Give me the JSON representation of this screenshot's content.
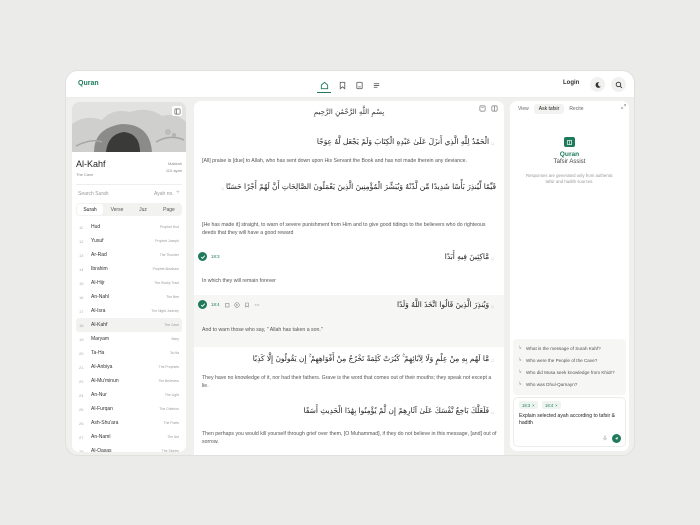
{
  "header": {
    "brand": "Quran",
    "login_label": "Login",
    "nav_icons": [
      "home-icon",
      "bookmark-icon",
      "book-icon",
      "list-icon"
    ],
    "accent_color": "#1f7a5c"
  },
  "surah": {
    "name": "Al-Kahf",
    "subtitle": "The Cave",
    "place": "Makkah",
    "ayah_count": "110 ayah",
    "search_placeholder": "Search Surah",
    "ayah_label": "Ayah no.",
    "plus": "+",
    "tabs": [
      "Surah",
      "Verse",
      "Juz",
      "Page"
    ],
    "active_tab": "Surah",
    "list": [
      {
        "num": "11",
        "name": "Hud",
        "meaning": "Prophet Hud"
      },
      {
        "num": "12",
        "name": "Yusuf",
        "meaning": "Prophet Joseph"
      },
      {
        "num": "13",
        "name": "Ar-Rad",
        "meaning": "The Thunder"
      },
      {
        "num": "14",
        "name": "Ibrahim",
        "meaning": "Prophet Abraham"
      },
      {
        "num": "15",
        "name": "Al-Hijr",
        "meaning": "The Rocky Tract"
      },
      {
        "num": "16",
        "name": "An-Nahl",
        "meaning": "The Bee"
      },
      {
        "num": "17",
        "name": "Al-Isra",
        "meaning": "The Night Journey"
      },
      {
        "num": "18",
        "name": "Al-Kahf",
        "meaning": "The Cave",
        "selected": true
      },
      {
        "num": "19",
        "name": "Maryam",
        "meaning": "Mary"
      },
      {
        "num": "20",
        "name": "Ta-Ha",
        "meaning": "Ta-Ha"
      },
      {
        "num": "21",
        "name": "Al-Anbiya",
        "meaning": "The Prophets"
      },
      {
        "num": "22",
        "name": "Al-Mu'minun",
        "meaning": "The Believers"
      },
      {
        "num": "24",
        "name": "An-Nur",
        "meaning": "The Light"
      },
      {
        "num": "25",
        "name": "Al-Furqan",
        "meaning": "The Criterion"
      },
      {
        "num": "26",
        "name": "Ash-Shu'ara",
        "meaning": "The Poets"
      },
      {
        "num": "27",
        "name": "An-Naml",
        "meaning": "The Ant"
      },
      {
        "num": "28",
        "name": "Al-Qasas",
        "meaning": "The Stories"
      }
    ]
  },
  "reader": {
    "bismillah": "بِسْمِ اللَّهِ الرَّحْمَٰنِ الرَّحِيمِ",
    "ayahs": [
      {
        "arabic": "الْحَمْدُ لِلَّهِ الَّذِي أَنزَلَ عَلَىٰ عَبْدِهِ الْكِتَابَ وَلَمْ يَجْعَل لَّهُ عِوَجًا",
        "english": "[All] praise is [due] to Allah, who has sent down upon His Servant the Book and has not made therein any deviance."
      },
      {
        "arabic": "قَيِّمًا لِّيُنذِرَ بَأْسًا شَدِيدًا مِّن لَّدُنْهُ وَيُبَشِّرَ الْمُؤْمِنِينَ الَّذِينَ يَعْمَلُونَ الصَّالِحَاتِ أَنَّ لَهُمْ أَجْرًا حَسَنًا",
        "english": "[He has made it] straight, to warn of severe punishment from Him and to give good tidings to the believers who do righteous deeds that they will have a good reward"
      },
      {
        "ref": "18:3",
        "arabic": "مَّاكِثِينَ فِيهِ أَبَدًا",
        "english": "In which they will remain forever"
      },
      {
        "ref": "18:4",
        "arabic": "وَيُنذِرَ الَّذِينَ قَالُوا اتَّخَذَ اللَّهُ وَلَدًا",
        "english": "And to warn those who say, \" Allah has taken a son.\""
      },
      {
        "arabic": "مَّا لَهُم بِهِ مِنْ عِلْمٍ وَلَا لِآبَائِهِمْ ۚ كَبُرَتْ كَلِمَةً تَخْرُجُ مِنْ أَفْوَاهِهِمْ ۚ إِن يَقُولُونَ إِلَّا كَذِبًا",
        "english": "They have no knowledge of it, nor had their fathers. Grave is the word that comes out of their mouths; they speak not except a lie."
      },
      {
        "arabic": "فَلَعَلَّكَ بَاخِعٌ نَّفْسَكَ عَلَىٰ آثَارِهِمْ إِن لَّمْ يُؤْمِنُوا بِهَٰذَا الْحَدِيثِ أَسَفًا",
        "english": "Then perhaps you would kill yourself through grief over them, [O Muhammad], if they do not believe in this message, [and] out of sorrow."
      }
    ]
  },
  "assistant": {
    "tabs": [
      "View",
      "Ask tafsir",
      "Recite"
    ],
    "active_tab": "Ask tafsir",
    "title": "Quran",
    "subtitle": "Tafsir Assist",
    "description": "Responses are generated only from authentic tafsir and hadith sources.",
    "suggestions": [
      "What is the message of Surah Kahf?",
      "Who were the People of the Cave?",
      "Who did Musa seek knowledge from Khidr?",
      "Who was Dhul-Qarnayn?"
    ],
    "chips": [
      "18:3",
      "18:4"
    ],
    "chip_close": "×",
    "input_text": "Explain selected ayah according to tafsir & hadith"
  }
}
